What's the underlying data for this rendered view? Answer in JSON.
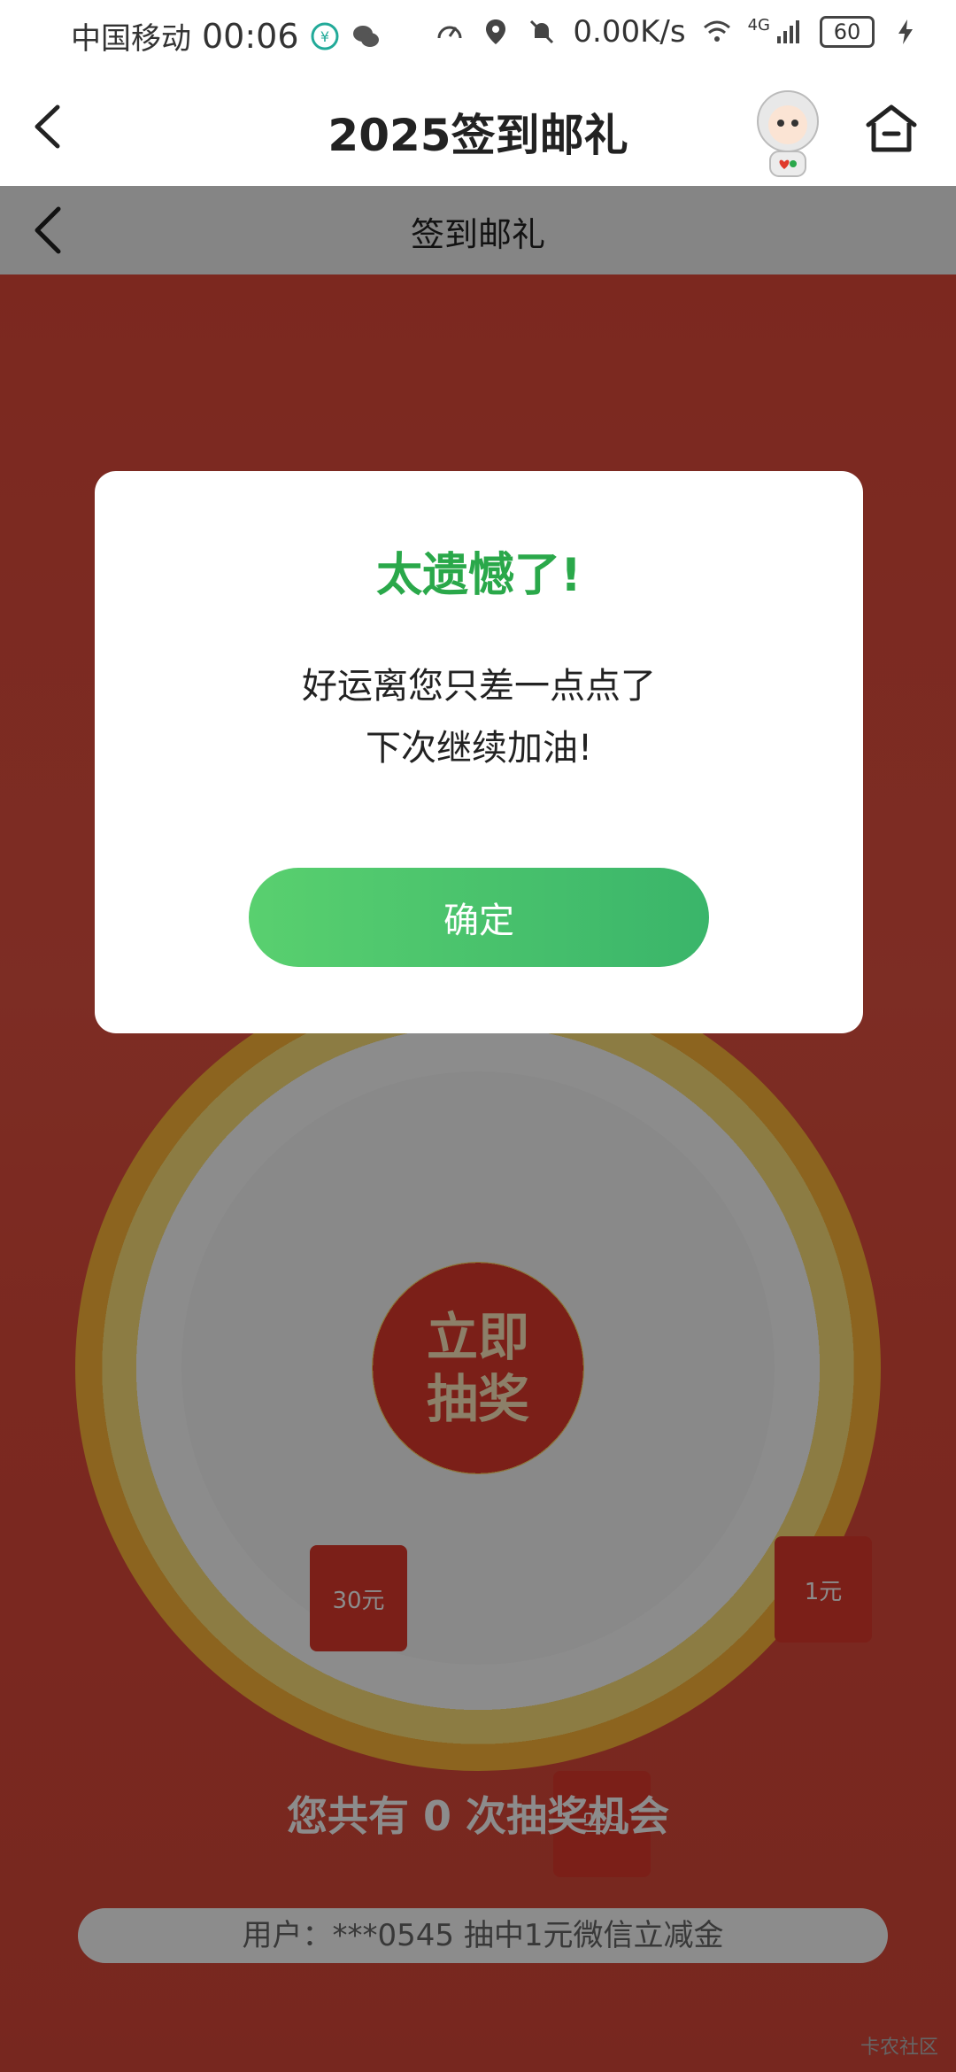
{
  "status_bar": {
    "carrier": "中国移动",
    "time": "00:06",
    "network_speed": "0.00K/s",
    "signal_label": "4G",
    "battery": "60"
  },
  "header": {
    "title": "2025签到邮礼",
    "icons": [
      "back-arrow-icon",
      "mascot-avatar",
      "home-icon"
    ]
  },
  "web": {
    "nav_title": "签到邮礼",
    "wheel": {
      "button_line1": "立即",
      "button_line2": "抽奖",
      "prizes": [
        "30元",
        "1元",
        "5元"
      ]
    },
    "chances_text": "您共有 0 次抽奖机会",
    "ticker_text": "用户：***0545 抽中1元微信立减金"
  },
  "modal": {
    "title": "太遗憾了!",
    "line1": "好运离您只差一点点了",
    "line2": "下次继续加油!",
    "confirm": "确定"
  },
  "watermark": "卡农社区",
  "colors": {
    "accent_green": "#2aa84a",
    "button_green_start": "#59d06f",
    "button_green_end": "#3ab56a",
    "page_red": "#e24a3a"
  }
}
